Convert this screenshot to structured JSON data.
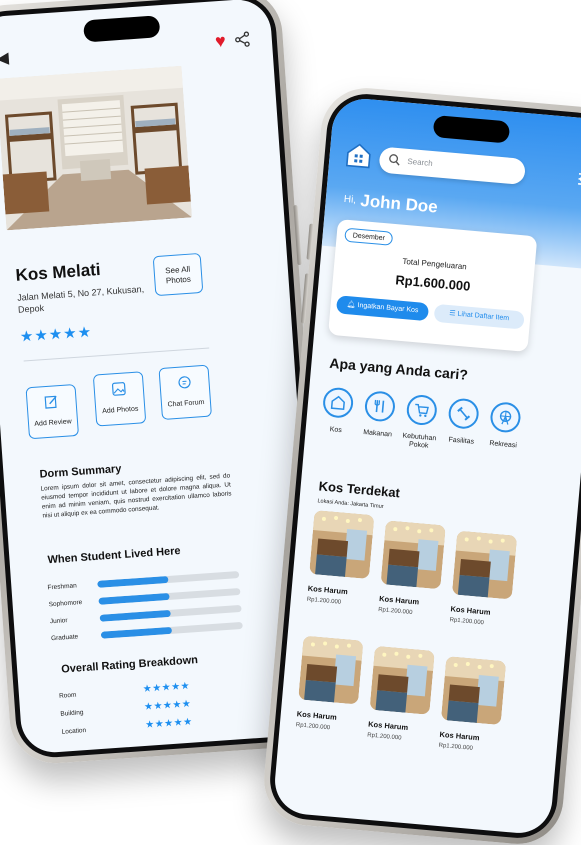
{
  "left": {
    "kos_name": "Kos Melati",
    "address": "Jalan Melati 5, No 27, Kukusan, Depok",
    "stars": "★★★★★",
    "see_all": "See All Photos",
    "actions": [
      "Add Review",
      "Add Photos",
      "Chat Forum"
    ],
    "summary_title": "Dorm Summary",
    "summary_text": "Lorem ipsum dolor sit amet, consectetur adipiscing elit, sed do eiusmod tempor incididunt ut labore et dolore magna aliqua. Ut enim ad minim veniam, quis nostrud exercitation ullamco laboris nisi ut aliquip ex ea commodo consequat.",
    "lived_title": "When Student Lived Here",
    "lived": [
      {
        "label": "Freshman",
        "value": 0.5
      },
      {
        "label": "Sophomore",
        "value": 0.5
      },
      {
        "label": "Junior",
        "value": 0.5
      },
      {
        "label": "Graduate",
        "value": 0.5
      }
    ],
    "rating_title": "Overall Rating Breakdown",
    "ratings": [
      {
        "label": "Room",
        "stars": "★★★★★"
      },
      {
        "label": "Building",
        "stars": "★★★★★"
      },
      {
        "label": "Location",
        "stars": "★★★★★"
      }
    ],
    "colors": {
      "accent": "#1d8ff0",
      "heart": "#e11b2b"
    }
  },
  "right": {
    "search_placeholder": "Search",
    "greeting_hi": "Hi,",
    "user_name": "John Doe",
    "month": "Desember",
    "total_label": "Total Pengeluaran",
    "total_value": "Rp1.600.000",
    "remind_button": "Ingatkan Bayar Kos",
    "list_button": "Lihat Daftar Item",
    "question_title": "Apa yang Anda cari?",
    "categories": [
      "Kos",
      "Makanan",
      "Kebutuhan Pokok",
      "Fasilitas",
      "Rekreasi"
    ],
    "nearby_title": "Kos Terdekat",
    "location": "Lokasi Anda: Jakarta Timur",
    "items": [
      {
        "name": "Kos Harum",
        "price": "Rp1.200.000"
      },
      {
        "name": "Kos Harum",
        "price": "Rp1.200.000"
      },
      {
        "name": "Kos Harum",
        "price": "Rp1.200.000"
      },
      {
        "name": "Kos Harum",
        "price": "Rp1.200.000"
      },
      {
        "name": "Kos Harum",
        "price": "Rp1.200.000"
      },
      {
        "name": "Kos Harum",
        "price": "Rp1.200.000"
      }
    ],
    "colors": {
      "primary": "#2a8fe6",
      "header": "#2f8ff0"
    }
  }
}
